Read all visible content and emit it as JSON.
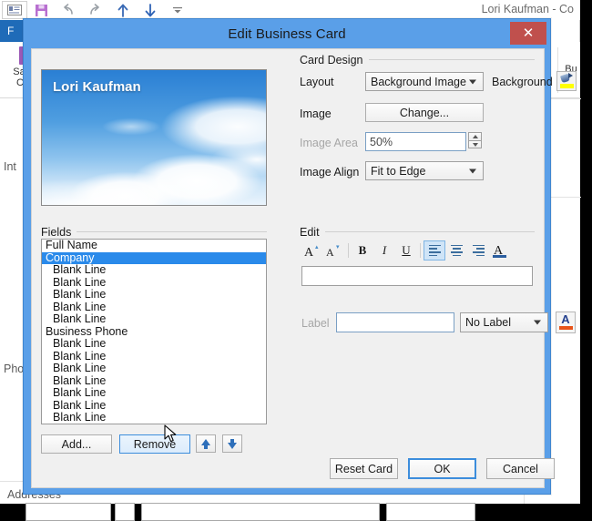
{
  "background_window": {
    "title": "Lori Kaufman - Co",
    "file_tab": "F",
    "quick_access": [
      {
        "name": "contact-card-icon",
        "glyph": "▤"
      },
      {
        "name": "save-icon",
        "glyph": "▢"
      },
      {
        "name": "undo-icon",
        "glyph": "↶"
      },
      {
        "name": "redo-icon",
        "glyph": "↷"
      },
      {
        "name": "previous-item-icon",
        "glyph": "↑"
      },
      {
        "name": "next-item-icon",
        "glyph": "↓"
      },
      {
        "name": "customize-qat-icon",
        "glyph": "⌄"
      }
    ],
    "ribbon_groups": [
      {
        "label_line1": "Save &",
        "label_line2": "Close"
      },
      {
        "label_line1": "Bu",
        "label_line2": ""
      }
    ],
    "form_labels": [
      "Int",
      "Pho",
      "Addresses"
    ]
  },
  "dialog": {
    "title": "Edit Business Card",
    "close_label": "✕",
    "card_preview": {
      "name": "Lori Kaufman"
    },
    "card_design": {
      "group_label": "Card Design",
      "layout_label": "Layout",
      "layout_value": "Background Image",
      "background_label": "Background",
      "background_icon": "paint-bucket-icon",
      "background_color": "#ffff00",
      "image_label": "Image",
      "image_button": "Change...",
      "image_area_label": "Image Area",
      "image_area_value": "50%",
      "image_align_label": "Image Align",
      "image_align_value": "Fit to Edge"
    },
    "fields": {
      "group_label": "Fields",
      "items": [
        {
          "label": "Full Name",
          "indent": false,
          "selected": false
        },
        {
          "label": "Company",
          "indent": false,
          "selected": true
        },
        {
          "label": "Blank Line",
          "indent": true,
          "selected": false
        },
        {
          "label": "Blank Line",
          "indent": true,
          "selected": false
        },
        {
          "label": "Blank Line",
          "indent": true,
          "selected": false
        },
        {
          "label": "Blank Line",
          "indent": true,
          "selected": false
        },
        {
          "label": "Blank Line",
          "indent": true,
          "selected": false
        },
        {
          "label": "Business Phone",
          "indent": false,
          "selected": false
        },
        {
          "label": "Blank Line",
          "indent": true,
          "selected": false
        },
        {
          "label": "Blank Line",
          "indent": true,
          "selected": false
        },
        {
          "label": "Blank Line",
          "indent": true,
          "selected": false
        },
        {
          "label": "Blank Line",
          "indent": true,
          "selected": false
        },
        {
          "label": "Blank Line",
          "indent": true,
          "selected": false
        },
        {
          "label": "Blank Line",
          "indent": true,
          "selected": false
        },
        {
          "label": "Blank Line",
          "indent": true,
          "selected": false
        }
      ],
      "add_button": "Add...",
      "remove_button": "Remove",
      "move_up_icon": "arrow-up-icon",
      "move_down_icon": "arrow-down-icon"
    },
    "edit": {
      "group_label": "Edit",
      "toolbar": [
        {
          "name": "increase-font-size-icon",
          "glyph": "A"
        },
        {
          "name": "decrease-font-size-icon",
          "glyph": "A"
        },
        {
          "name": "bold-icon",
          "glyph": "B"
        },
        {
          "name": "italic-icon",
          "glyph": "I"
        },
        {
          "name": "underline-icon",
          "glyph": "U"
        },
        {
          "name": "align-left-icon",
          "glyph": ""
        },
        {
          "name": "align-center-icon",
          "glyph": ""
        },
        {
          "name": "align-right-icon",
          "glyph": ""
        },
        {
          "name": "font-color-icon",
          "glyph": "A"
        }
      ],
      "value_text": "",
      "label_caption": "Label",
      "label_value": "",
      "label_position": "No Label",
      "label_font_color_icon": "font-color-icon",
      "label_font_color": "#e8541a"
    },
    "footer": {
      "reset_button": "Reset Card",
      "ok_button": "OK",
      "cancel_button": "Cancel"
    }
  }
}
